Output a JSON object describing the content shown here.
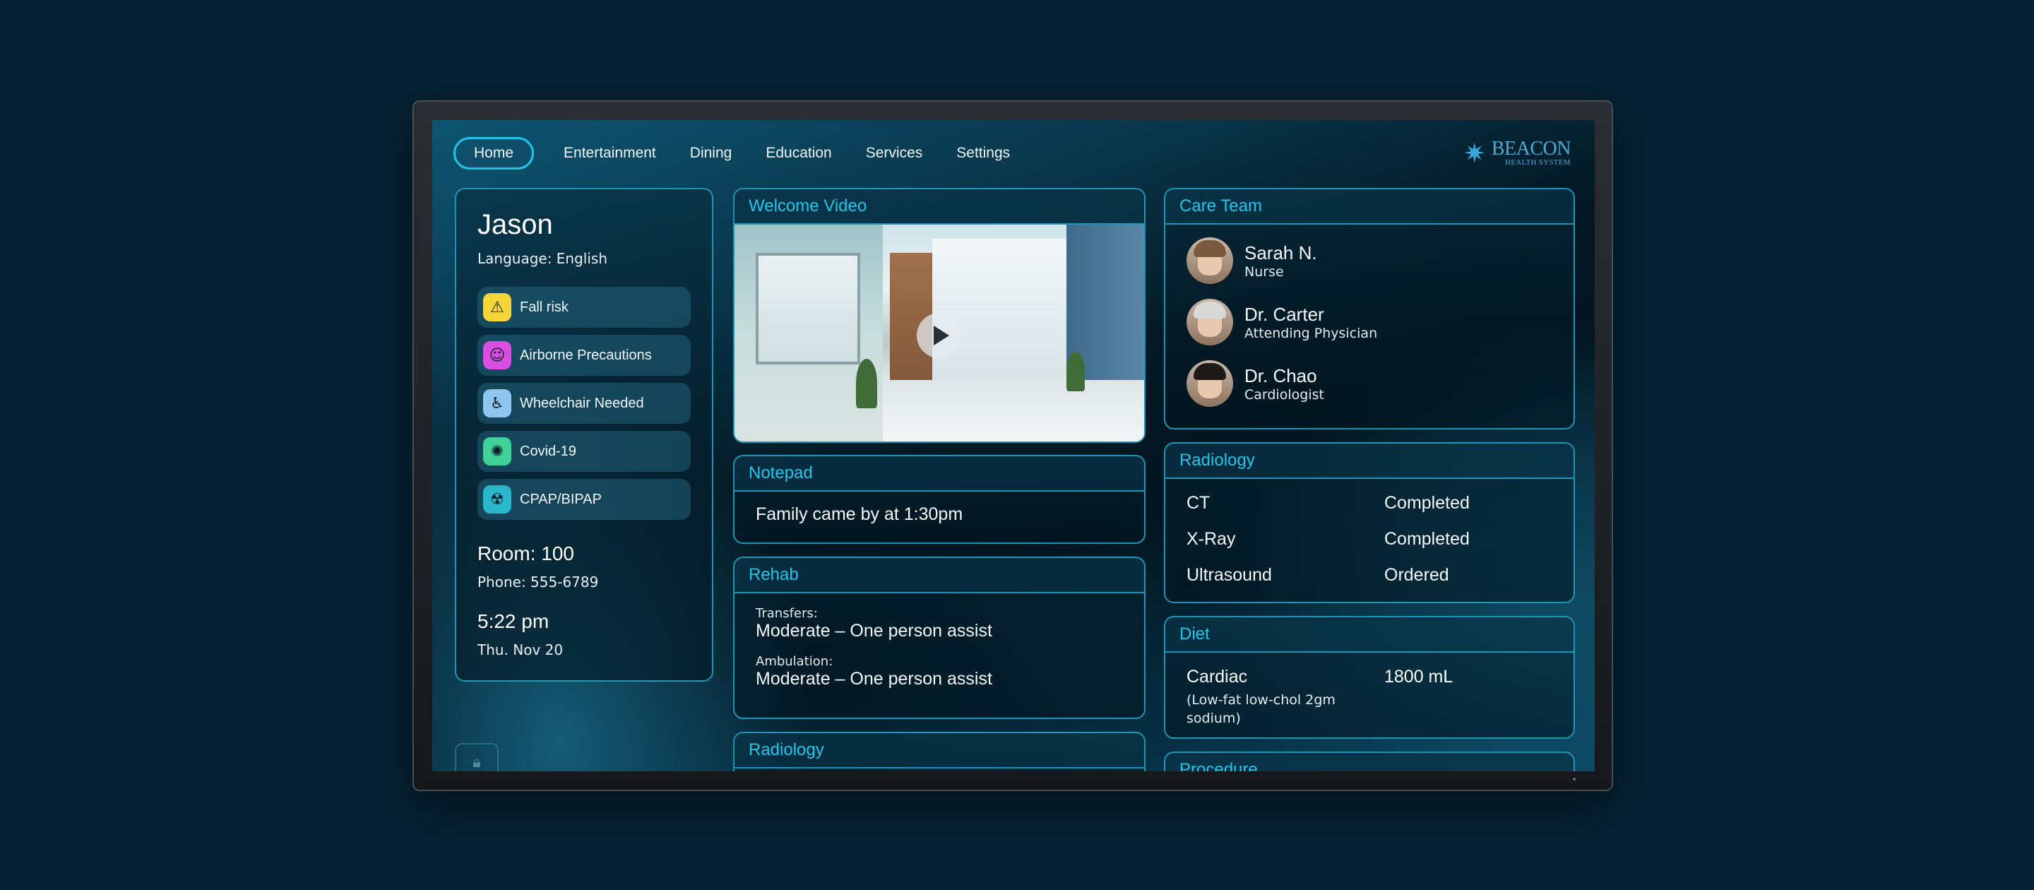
{
  "nav": {
    "items": [
      {
        "label": "Home",
        "active": true
      },
      {
        "label": "Entertainment"
      },
      {
        "label": "Dining"
      },
      {
        "label": "Education"
      },
      {
        "label": "Services"
      },
      {
        "label": "Settings"
      }
    ]
  },
  "logo": {
    "main": "BEACON",
    "sub": "HEALTH SYSTEM"
  },
  "patient": {
    "name": "Jason",
    "language": "Language: English",
    "alerts": [
      {
        "label": "Fall risk",
        "icon": "fall-risk-icon",
        "color": "#f5d63a"
      },
      {
        "label": "Airborne Precautions",
        "icon": "mask-icon",
        "color": "#d94ee0"
      },
      {
        "label": "Wheelchair Needed",
        "icon": "wheelchair-icon",
        "color": "#8fc6ef"
      },
      {
        "label": "Covid-19",
        "icon": "virus-icon",
        "color": "#3fd39a"
      },
      {
        "label": "CPAP/BIPAP",
        "icon": "cpap-mask-icon",
        "color": "#2ab7c9"
      }
    ],
    "room": "Room: 100",
    "phone": "Phone: 555-6789",
    "time": "5:22 pm",
    "date": "Thu. Nov 20"
  },
  "welcome_video": {
    "title": "Welcome Video"
  },
  "notepad": {
    "title": "Notepad",
    "text": "Family came by at 1:30pm"
  },
  "rehab": {
    "title": "Rehab",
    "items": [
      {
        "label": "Transfers:",
        "value": "Moderate – One person assist"
      },
      {
        "label": "Ambulation:",
        "value": "Moderate – One person assist"
      }
    ]
  },
  "radiology_lower": {
    "title": "Radiology"
  },
  "care_team": {
    "title": "Care Team",
    "members": [
      {
        "name": "Sarah N.",
        "role": "Nurse"
      },
      {
        "name": "Dr. Carter",
        "role": "Attending Physician"
      },
      {
        "name": "Dr. Chao",
        "role": "Cardiologist"
      }
    ]
  },
  "radiology": {
    "title": "Radiology",
    "rows": [
      {
        "test": "CT",
        "status": "Completed"
      },
      {
        "test": "X-Ray",
        "status": "Completed"
      },
      {
        "test": "Ultrasound",
        "status": "Ordered"
      }
    ]
  },
  "diet": {
    "title": "Diet",
    "name": "Cardiac",
    "description": "(Low-fat low-chol 2gm sodium)",
    "fluid": "1800 mL"
  },
  "procedure": {
    "title": "Procedure"
  },
  "colors": {
    "accent": "#23c6ea",
    "background": "#062132"
  }
}
